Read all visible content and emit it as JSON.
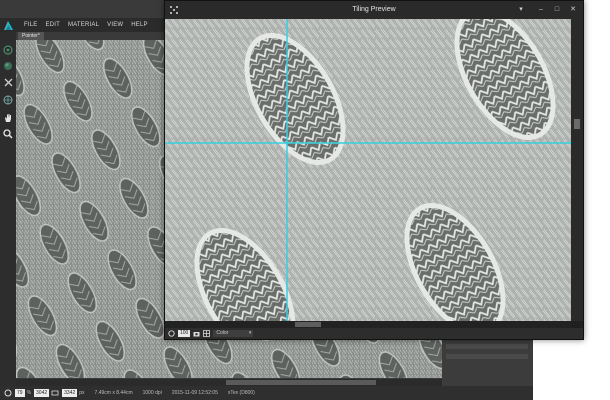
{
  "menu": {
    "items": [
      "FILE",
      "EDIT",
      "MATERIAL",
      "VIEW",
      "HELP"
    ]
  },
  "document": {
    "tab_label": "Pointer*"
  },
  "statusbar": {
    "zoom_value": "79",
    "zoom_unit": "%",
    "width_value": "3042",
    "height_value": "3342",
    "size_unit": "px",
    "physical_size": "7.49cm x 8.44cm",
    "dpi": "1000 dpi",
    "timestamp": "2015-11-09 12:52:05",
    "device": "xTex (D800)"
  },
  "tiling_preview": {
    "title": "Tiling Preview",
    "zoom_value": "100",
    "channel_selected": "Color",
    "guide_color": "#35d0e0"
  },
  "colors": {
    "accent_green": "#3aa33a",
    "app_logo": "#2fb6c6"
  },
  "icons": {
    "accept": "checkmark-icon",
    "pan": "hand-icon",
    "zoom": "magnifier-icon"
  }
}
